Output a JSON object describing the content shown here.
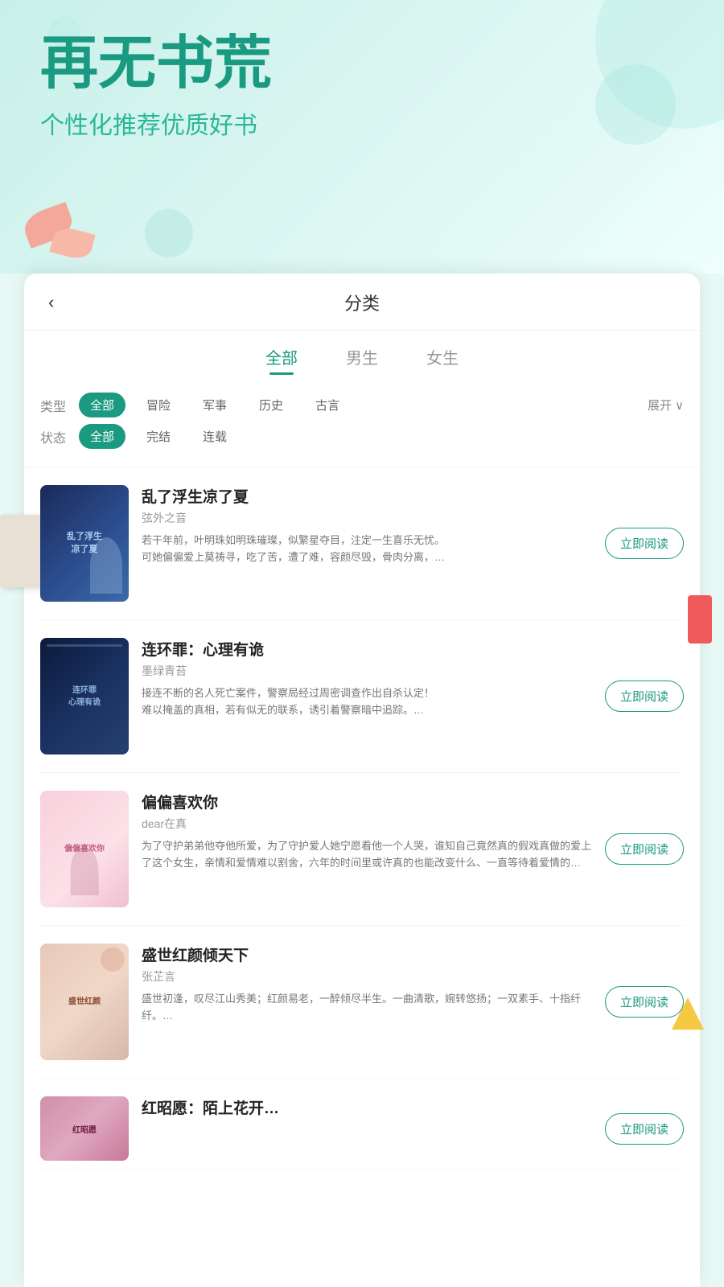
{
  "hero": {
    "title": "再无书荒",
    "subtitle": "个性化推荐优质好书"
  },
  "header": {
    "back_label": "‹",
    "title": "分类"
  },
  "tabs": [
    {
      "label": "全部",
      "active": true
    },
    {
      "label": "男生",
      "active": false
    },
    {
      "label": "女生",
      "active": false
    }
  ],
  "filters": {
    "type": {
      "label": "类型",
      "tags": [
        {
          "label": "全部",
          "active": true
        },
        {
          "label": "冒险",
          "active": false
        },
        {
          "label": "军事",
          "active": false
        },
        {
          "label": "历史",
          "active": false
        },
        {
          "label": "古言",
          "active": false
        }
      ],
      "expand": "展开"
    },
    "status": {
      "label": "状态",
      "tags": [
        {
          "label": "全部",
          "active": true
        },
        {
          "label": "完结",
          "active": false
        },
        {
          "label": "连载",
          "active": false
        }
      ]
    }
  },
  "books": [
    {
      "id": 1,
      "title": "乱了浮生凉了夏",
      "author": "弦外之音",
      "desc": "若干年前，叶明珠如明珠璀璨，似繁星夺目，注定一生喜乐无忧。\n可她偏偏爱上莫祷寻，吃了苦，遭了难，容颜尽毁，骨肉分离，…",
      "read_btn": "立即阅读",
      "cover_color": "#1a3a6b",
      "cover_text": "乱了浮生\n凉了夏"
    },
    {
      "id": 2,
      "title": "连环罪：心理有诡",
      "author": "墨绿青苔",
      "desc": "接连不断的名人死亡案件，警察局经过周密调查作出自杀认定！\n难以掩盖的真相，若有似无的联系，诱引着警察暗中追踪。…",
      "read_btn": "立即阅读",
      "cover_color": "#2a4a7a",
      "cover_text": "连环罪\n心理有诡"
    },
    {
      "id": 3,
      "title": "偏偏喜欢你",
      "author": "dear在真",
      "desc": "为了守护弟弟他夺他所爱，为了守护爱人她宁愿看他一个人哭，谁知自己竟然真的假戏真做的爱上了这个女生，亲情和爱情难以割舍，六年的时间里或许真的也能改变什么、一直等待着爱情的…",
      "read_btn": "立即阅读",
      "cover_color": "#f8c8d4",
      "cover_text": "偏偏喜欢你"
    },
    {
      "id": 4,
      "title": "盛世红颜倾天下",
      "author": "张芷言",
      "desc": "盛世初逢，叹尽江山秀美；\n红颜易老，一醉倾尽半生。\n一曲清歌，婉转悠扬；一双素手、十指纤纤。…",
      "read_btn": "立即阅读",
      "cover_color": "#e8d0c0",
      "cover_text": "盛世红颜"
    },
    {
      "id": 5,
      "title": "红昭愿：陌上花开…",
      "author": "",
      "desc": "",
      "read_btn": "立即阅读",
      "cover_color": "#d4a0b0",
      "cover_text": "红昭愿"
    }
  ]
}
